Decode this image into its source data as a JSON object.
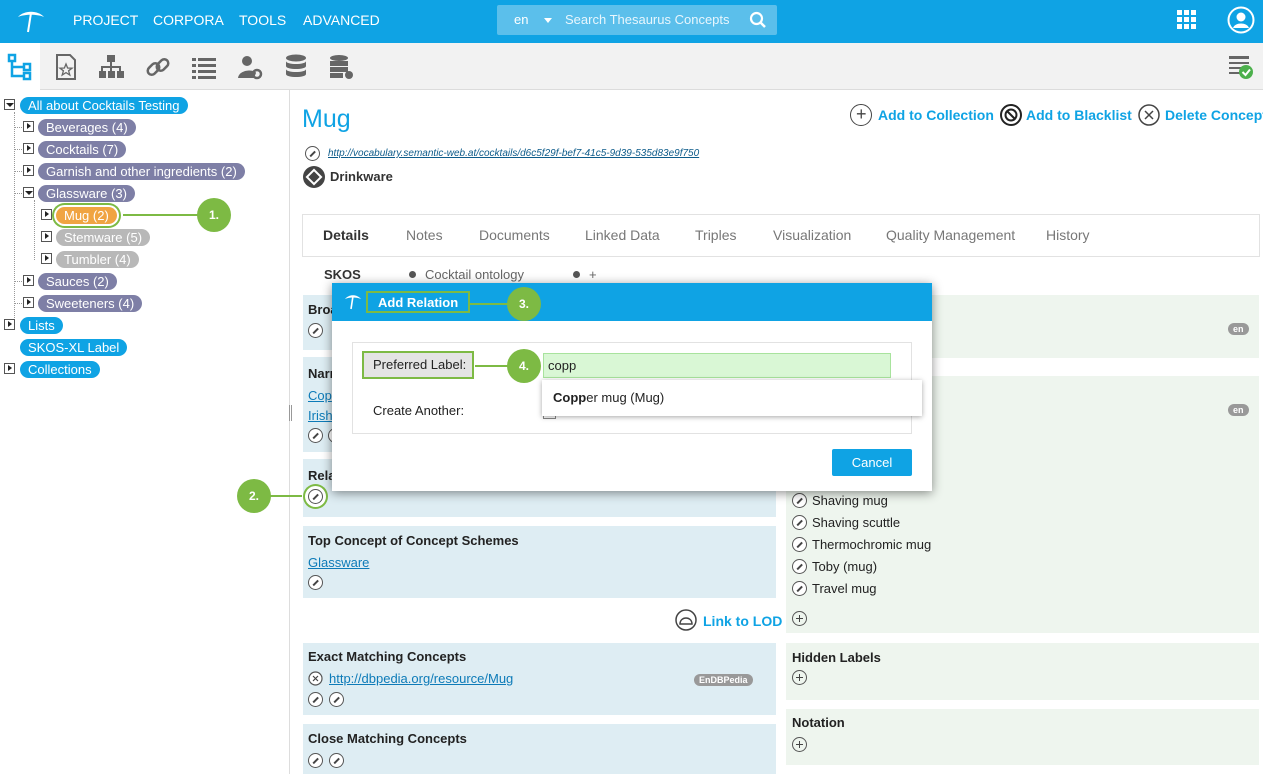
{
  "topbar": {
    "menu": [
      "PROJECT",
      "CORPORA",
      "TOOLS",
      "ADVANCED"
    ],
    "search_lang": "en",
    "search_placeholder": "Search Thesaurus Concepts"
  },
  "toolbar": {
    "icons": [
      "hierarchy-icon",
      "concept-schemes-icon",
      "org-chart-icon",
      "link-icon",
      "list-icon",
      "user-settings-icon",
      "database-icon",
      "server-settings-icon",
      "quality-check-icon"
    ]
  },
  "tree": {
    "root": "All about Cocktails Testing",
    "items": [
      {
        "label": "Beverages (4)"
      },
      {
        "label": "Cocktails (7)"
      },
      {
        "label": "Garnish and other ingredients (2)"
      },
      {
        "label": "Glassware (3)"
      },
      {
        "label": "Mug (2)"
      },
      {
        "label": "Stemware (5)"
      },
      {
        "label": "Tumbler (4)"
      },
      {
        "label": "Sauces (2)"
      },
      {
        "label": "Sweeteners (4)"
      }
    ],
    "lists": "Lists",
    "skosxl": "SKOS-XL Label",
    "collections": "Collections"
  },
  "callouts": {
    "c1": "1.",
    "c2": "2.",
    "c3": "3.",
    "c4": "4."
  },
  "concept": {
    "title": "Mug",
    "uri": "http://vocabulary.semantic-web.at/cocktails/d6c5f29f-bef7-41c5-9d39-535d83e9f750",
    "scheme": "Drinkware"
  },
  "actions": {
    "add_collection": "Add to Collection",
    "add_blacklist": "Add to Blacklist",
    "delete": "Delete Concept"
  },
  "tabs": [
    "Details",
    "Notes",
    "Documents",
    "Linked Data",
    "Triples",
    "Visualization",
    "Quality Management",
    "History"
  ],
  "subtabs": [
    "SKOS",
    "Cocktail ontology",
    "+"
  ],
  "left_panels": {
    "broader": "Broa",
    "narrower": "Narr",
    "narrower_links": [
      "Cop",
      "Irish"
    ],
    "related": "Rela",
    "top_concept_title": "Top Concept of Concept Schemes",
    "top_concept_link": "Glassware",
    "link_to_lod": "Link to LOD",
    "exact_title": "Exact Matching Concepts",
    "exact_link": "http://dbpedia.org/resource/Mug",
    "exact_badge": "EnDBPedia",
    "close_title": "Close Matching Concepts"
  },
  "right_panels": {
    "en_badge": "en",
    "labels": [
      "Shaving mug",
      "Shaving scuttle",
      "Thermochromic mug",
      "Toby (mug)",
      "Travel mug"
    ],
    "hidden_title": "Hidden Labels",
    "notation_title": "Notation"
  },
  "modal": {
    "title": "Add Relation",
    "pref_label": "Preferred Label:",
    "input_value": "copp",
    "create_another": "Create Another:",
    "suggestion_bold": "Copp",
    "suggestion_rest": "er mug (Mug)",
    "cancel": "Cancel"
  }
}
